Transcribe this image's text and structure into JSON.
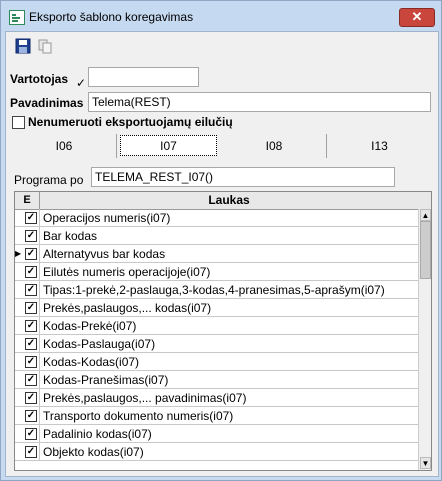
{
  "window": {
    "title": "Eksporto šablono koregavimas",
    "close_glyph": "✕"
  },
  "toolbar": {
    "save_icon": "floppy-disk",
    "copy_icon": "copy"
  },
  "form": {
    "vartotojas_label": "Vartotojas",
    "vartotojas_value": "",
    "vartotojas_checked": "✓",
    "pavadinimas_label": "Pavadinimas",
    "pavadinimas_value": "Telema(REST)",
    "nenumeruoti_label": "Nenumeruoti eksportuojamų eilučių",
    "nenumeruoti_checked": false
  },
  "tabs": [
    {
      "label": "I06",
      "active": false
    },
    {
      "label": "I07",
      "active": true
    },
    {
      "label": "I08",
      "active": false
    },
    {
      "label": "I13",
      "active": false
    }
  ],
  "programa": {
    "label": "Programa po",
    "value": "TELEMA_REST_I07()"
  },
  "grid": {
    "col_e": "E",
    "col_laukas": "Laukas",
    "current_row_marker": "▶",
    "current_row": 2,
    "rows": [
      {
        "checked": true,
        "label": "Operacijos numeris(i07)"
      },
      {
        "checked": true,
        "label": "Bar kodas"
      },
      {
        "checked": true,
        "label": "Alternatyvus bar kodas"
      },
      {
        "checked": true,
        "label": "Eilutės numeris operacijoje(i07)"
      },
      {
        "checked": true,
        "label": "Tipas:1-prekė,2-paslauga,3-kodas,4-pranesimas,5-aprašym(i07)"
      },
      {
        "checked": true,
        "label": "Prekės,paslaugos,... kodas(i07)"
      },
      {
        "checked": true,
        "label": "Kodas-Prekė(i07)"
      },
      {
        "checked": true,
        "label": "Kodas-Paslauga(i07)"
      },
      {
        "checked": true,
        "label": "Kodas-Kodas(i07)"
      },
      {
        "checked": true,
        "label": "Kodas-Pranešimas(i07)"
      },
      {
        "checked": true,
        "label": "Prekės,paslaugos,... pavadinimas(i07)"
      },
      {
        "checked": true,
        "label": "Transporto dokumento numeris(i07)"
      },
      {
        "checked": true,
        "label": "Padalinio kodas(i07)"
      },
      {
        "checked": true,
        "label": "Objekto kodas(i07)"
      }
    ],
    "scroll_up": "▲",
    "scroll_down": "▼"
  }
}
